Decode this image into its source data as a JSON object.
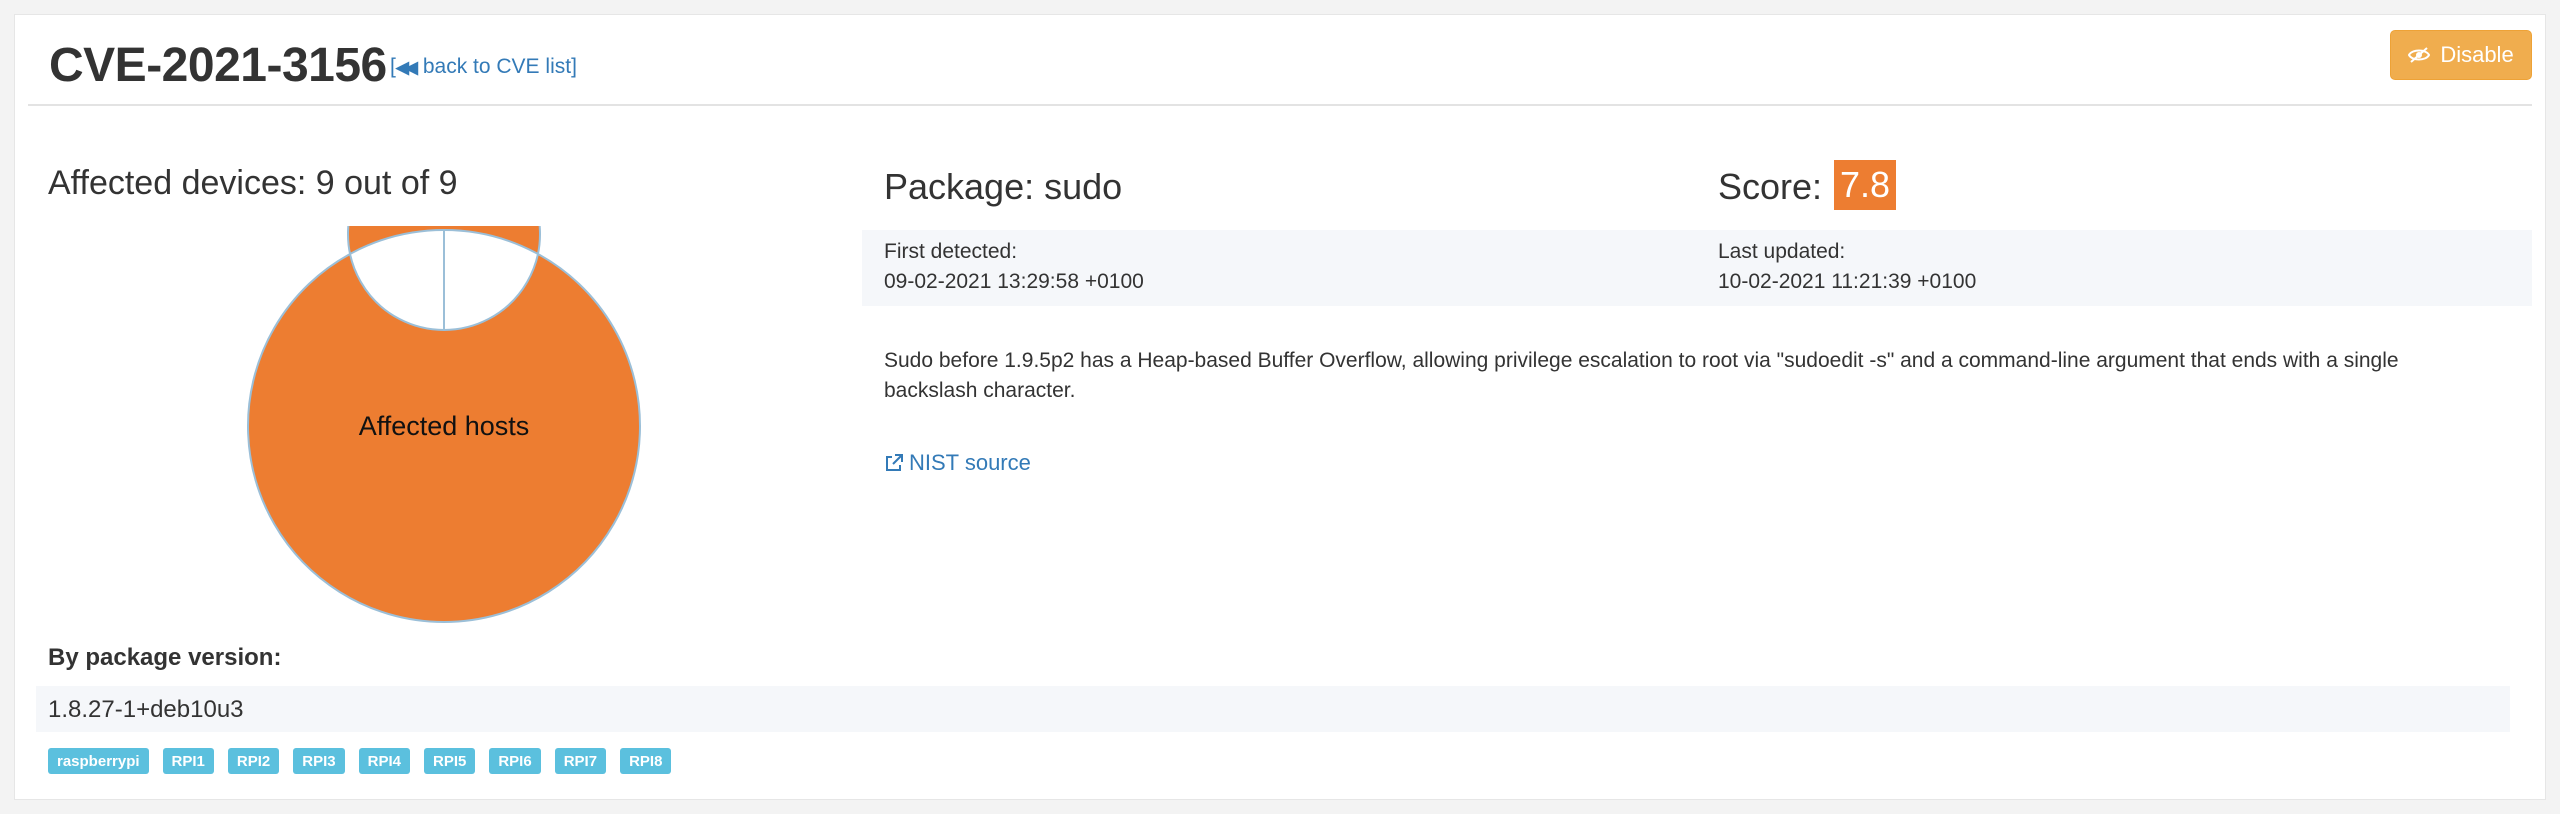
{
  "header": {
    "title": "CVE-2021-3156",
    "back_link_label": "back to CVE list",
    "disable_label": "Disable"
  },
  "affected": {
    "title": "Affected devices: 9 out of 9",
    "chart_center_label": "Affected hosts"
  },
  "chart_data": {
    "type": "pie",
    "title": "",
    "slices": [
      {
        "name": "",
        "value": 9,
        "color": "#ed7d31"
      },
      {
        "name": "",
        "value": 0,
        "color": "#9bbfd8"
      }
    ]
  },
  "package": {
    "title": "Package: sudo",
    "first_detected_label": "First detected:",
    "first_detected_value": "09-02-2021 13:29:58 +0100"
  },
  "score": {
    "label": "Score:",
    "value": "7.8",
    "color": "#ed7d31",
    "last_updated_label": "Last updated:",
    "last_updated_value": "10-02-2021 11:21:39 +0100"
  },
  "description": "Sudo before 1.9.5p2 has a Heap-based Buffer Overflow, allowing privilege escalation to root via \"sudoedit -s\" and a command-line argument that ends with a single backslash character.",
  "nist_link_label": "NIST source",
  "versions": {
    "title": "By package version:",
    "items": [
      {
        "version": "1.8.27-1+deb10u3",
        "hosts": [
          "raspberrypi",
          "RPI1",
          "RPI2",
          "RPI3",
          "RPI4",
          "RPI5",
          "RPI6",
          "RPI7",
          "RPI8"
        ]
      }
    ]
  },
  "colors": {
    "link": "#337ab7",
    "warning_button": "#f0ad4e",
    "host_tag": "#5bc0de",
    "donut_fill": "#ed7d31"
  }
}
